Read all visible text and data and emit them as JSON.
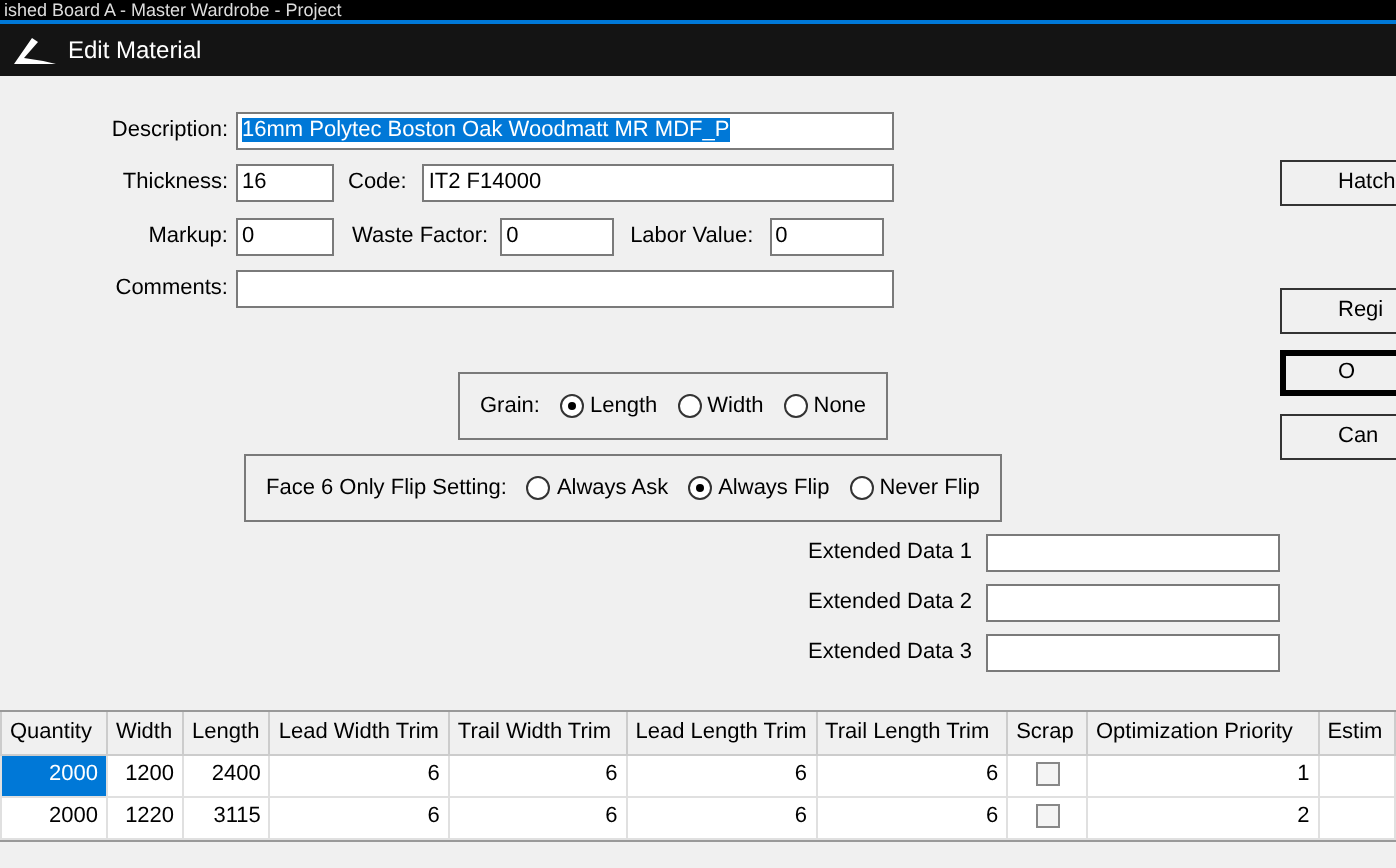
{
  "background_title": "ished Board A - Master Wardrobe - Project",
  "window": {
    "title": "Edit Material"
  },
  "description": {
    "label": "Description:",
    "value": "16mm Polytec Boston Oak Woodmatt MR MDF_P",
    "text_selected": true
  },
  "thickness": {
    "label": "Thickness:",
    "value": "16"
  },
  "code": {
    "label": "Code:",
    "value": "IT2 F14000"
  },
  "markup": {
    "label": "Markup:",
    "value": "0"
  },
  "waste_factor": {
    "label": "Waste Factor:",
    "value": "0"
  },
  "labor_value": {
    "label": "Labor Value:",
    "value": "0"
  },
  "comments": {
    "label": "Comments:"
  },
  "grain": {
    "label": "Grain:",
    "options": [
      {
        "label": "Length",
        "selected": true
      },
      {
        "label": "Width",
        "selected": false
      },
      {
        "label": "None",
        "selected": false
      }
    ]
  },
  "face6_flip": {
    "label": "Face 6 Only Flip Setting:",
    "options": [
      {
        "label": "Always Ask",
        "selected": false
      },
      {
        "label": "Always Flip",
        "selected": true
      },
      {
        "label": "Never Flip",
        "selected": false
      }
    ]
  },
  "extended_data": [
    {
      "label": "Extended Data 1"
    },
    {
      "label": "Extended Data 2"
    },
    {
      "label": "Extended Data 3"
    }
  ],
  "buttons": [
    {
      "label": "Hatch",
      "default": false
    },
    {
      "label": "Regi",
      "default": false
    },
    {
      "label": "O",
      "default": true
    },
    {
      "label": "Can",
      "default": false
    }
  ],
  "table": {
    "columns": [
      "Quantity",
      "Width",
      "Length",
      "Lead Width Trim",
      "Trail Width Trim",
      "Lead Length Trim",
      "Trail Length Trim",
      "Scrap",
      "Optimization Priority",
      "Estim"
    ],
    "rows": [
      {
        "selected": true,
        "cells": [
          "2000",
          "1200",
          "2400",
          "6",
          "6",
          "6",
          "6"
        ],
        "scrap": false,
        "optimization_priority": "1"
      },
      {
        "selected": false,
        "cells": [
          "2000",
          "1220",
          "3115",
          "6",
          "6",
          "6",
          "6"
        ],
        "scrap": false,
        "optimization_priority": "2"
      }
    ]
  }
}
